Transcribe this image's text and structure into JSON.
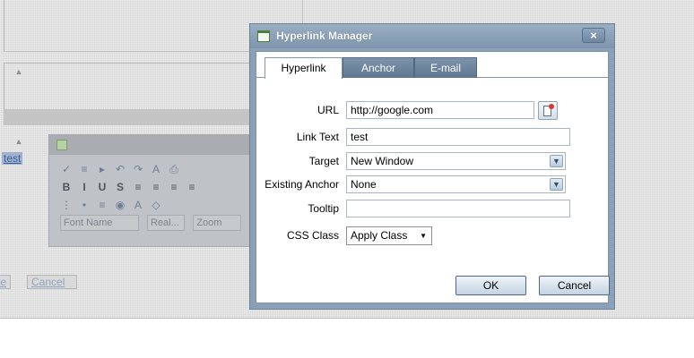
{
  "background": {
    "selected_text": "test",
    "editor_selects": [
      "Font Name",
      "Real...",
      "Zoom"
    ],
    "buttons": [
      "te",
      "Cancel"
    ]
  },
  "dialog": {
    "title": "Hyperlink Manager",
    "close_label": "×",
    "tabs": [
      {
        "label": "Hyperlink",
        "active": true
      },
      {
        "label": "Anchor",
        "active": false
      },
      {
        "label": "E-mail",
        "active": false
      }
    ],
    "form": {
      "url_label": "URL",
      "url_value": "http://google.com",
      "link_text_label": "Link Text",
      "link_text_value": "test",
      "target_label": "Target",
      "target_value": "New Window",
      "existing_anchor_label": "Existing Anchor",
      "existing_anchor_value": "None",
      "tooltip_label": "Tooltip",
      "tooltip_value": "",
      "css_class_label": "CSS Class",
      "css_class_value": "Apply Class"
    },
    "ok_label": "OK",
    "cancel_label": "Cancel"
  },
  "colors": {
    "dialog_frame": "#8aa0b6",
    "tab_inactive": "#6a8199",
    "background_overlay": "#d4d4d4"
  },
  "icons": {
    "dialog": "hyperlink-manager-icon",
    "url_browse": "document-manager-icon",
    "close": "close-icon"
  }
}
